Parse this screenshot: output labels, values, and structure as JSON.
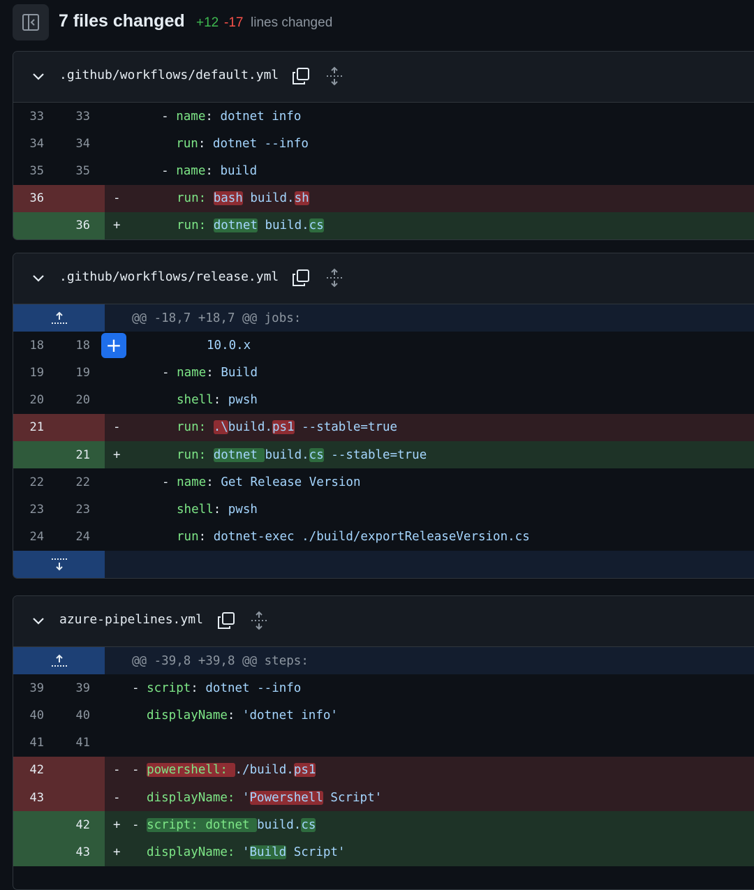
{
  "summary": {
    "files_changed": "7 files changed",
    "additions": "+12",
    "deletions": "-17",
    "lines_changed": "lines changed"
  },
  "colors": {
    "addition": "#3fb950",
    "deletion": "#f85149",
    "accent": "#1f6feb"
  },
  "files": [
    {
      "name": ".github/workflows/default.yml",
      "rows": [
        {
          "type": "ctx",
          "old": "33",
          "new": "33",
          "marker": "",
          "indent": "    ",
          "dash": "- ",
          "key": "name",
          "sep": ": ",
          "value": "dotnet info"
        },
        {
          "type": "ctx",
          "old": "34",
          "new": "34",
          "marker": "",
          "indent": "      ",
          "dash": "",
          "key": "run",
          "sep": ": ",
          "value": "dotnet --info"
        },
        {
          "type": "ctx",
          "old": "35",
          "new": "35",
          "marker": "",
          "indent": "    ",
          "dash": "- ",
          "key": "name",
          "sep": ": ",
          "value": "build"
        },
        {
          "type": "del",
          "old": "36",
          "new": "",
          "marker": "-"
        },
        {
          "type": "add",
          "old": "",
          "new": "36",
          "marker": "+"
        }
      ],
      "del_line": {
        "key": "run: ",
        "hl1": "bash",
        "mid": " build.",
        "hl2": "sh"
      },
      "add_line": {
        "key": "run: ",
        "hl1": "dotnet",
        "mid": " build.",
        "hl2": "cs"
      }
    },
    {
      "name": ".github/workflows/release.yml",
      "hunk": "@@ -18,7 +18,7 @@ jobs:",
      "rows": [
        {
          "old": "18",
          "new": "18",
          "text": "10.0.x"
        },
        {
          "old": "19",
          "new": "19",
          "dash": "- ",
          "key": "name",
          "value": "Build"
        },
        {
          "old": "20",
          "new": "20",
          "key": "shell",
          "value": "pwsh"
        },
        {
          "old": "21",
          "new": "",
          "marker": "-"
        },
        {
          "old": "",
          "new": "21",
          "marker": "+"
        },
        {
          "old": "22",
          "new": "22",
          "dash": "- ",
          "key": "name",
          "value": "Get Release Version"
        },
        {
          "old": "23",
          "new": "23",
          "key": "shell",
          "value": "pwsh"
        },
        {
          "old": "24",
          "new": "24",
          "key": "run",
          "value": "dotnet-exec ./build/exportReleaseVersion.cs"
        }
      ],
      "del_line": {
        "key": "run: ",
        "hl1": ".\\",
        "mid": "build.",
        "hl2": "ps1",
        "tail": " --stable=true"
      },
      "add_line": {
        "key": "run: ",
        "hl1": "dotnet ",
        "mid": "build.",
        "hl2": "cs",
        "tail": " --stable=true"
      }
    },
    {
      "name": "azure-pipelines.yml",
      "hunk": "@@ -39,8 +39,8 @@ steps:",
      "rows": [
        {
          "old": "39",
          "new": "39",
          "dash": "- ",
          "key": "script",
          "value": "dotnet --info"
        },
        {
          "old": "40",
          "new": "40",
          "key": "displayName",
          "value": "'dotnet info'"
        },
        {
          "old": "41",
          "new": "41"
        },
        {
          "old": "42",
          "new": "",
          "marker": "-"
        },
        {
          "old": "43",
          "new": "",
          "marker": "-"
        },
        {
          "old": "",
          "new": "42",
          "marker": "+"
        },
        {
          "old": "",
          "new": "43",
          "marker": "+"
        }
      ],
      "del1": {
        "dash": "- ",
        "hl": "powershell: ",
        "mid": "./build.",
        "hl2": "ps1"
      },
      "del2": {
        "key": "displayName: ",
        "q": "'",
        "hl": "Powershell",
        "tail": " Script'"
      },
      "add1": {
        "dash": "- ",
        "hl": "script: dotnet ",
        "mid": "build.",
        "hl2": "cs"
      },
      "add2": {
        "key": "displayName: ",
        "q": "'",
        "hl": "Build",
        "tail": " Script'"
      }
    }
  ]
}
